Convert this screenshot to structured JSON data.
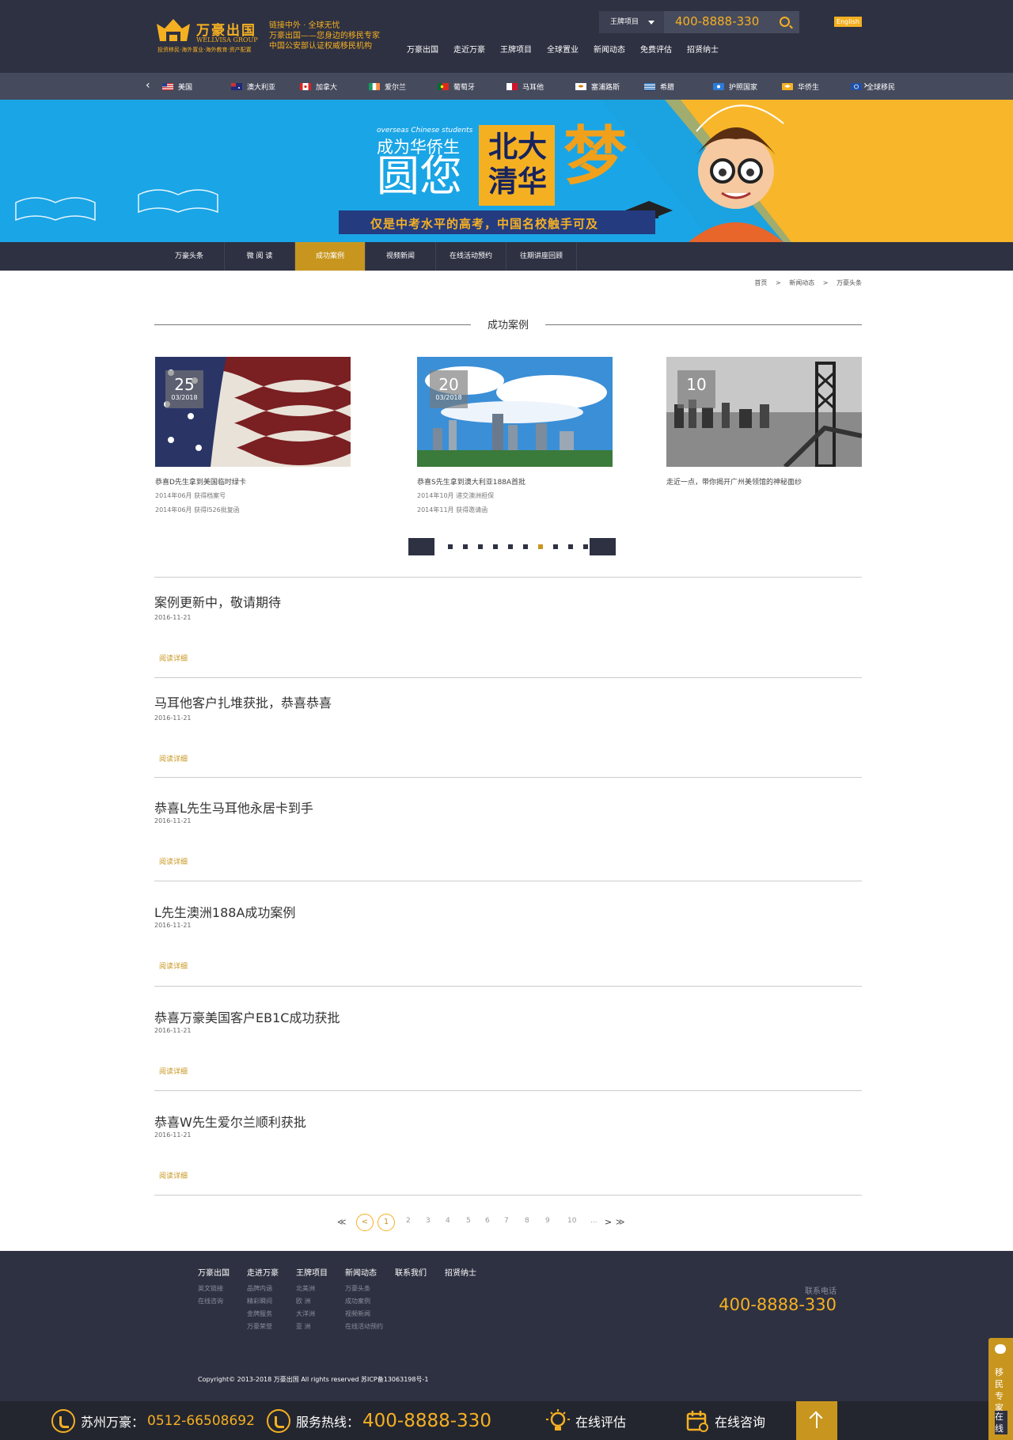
{
  "header": {
    "logo_title": "万豪出国",
    "logo_sub": "WELLVISA GROUP",
    "logo_tag": "投资移民·海外置业·海外教育·资产配置",
    "slogan": [
      "链接中外 · 全球无忧",
      "万豪出国——您身边的移民专家",
      "中国公安部认证权威移民机构"
    ],
    "search_category": "王牌项目",
    "search_phone": "400-8888-330",
    "lang_button": "English",
    "nav": [
      "万豪出国",
      "走近万豪",
      "王牌项目",
      "全球置业",
      "新闻动态",
      "免费评估",
      "招贤纳士"
    ]
  },
  "countries": [
    {
      "label": "美国",
      "flag": "us"
    },
    {
      "label": "澳大利亚",
      "flag": "au"
    },
    {
      "label": "加拿大",
      "flag": "ca"
    },
    {
      "label": "爱尔兰",
      "flag": "ie"
    },
    {
      "label": "葡萄牙",
      "flag": "pt"
    },
    {
      "label": "马耳他",
      "flag": "mt"
    },
    {
      "label": "塞浦路斯",
      "flag": "cy"
    },
    {
      "label": "希腊",
      "flag": "gr"
    },
    {
      "label": "护照国家",
      "flag": "passport"
    },
    {
      "label": "华侨生",
      "flag": "student"
    },
    {
      "label": "全球移民",
      "flag": "global"
    }
  ],
  "banner": {
    "subtitle": "overseas Chinese students",
    "line1": "成为华侨生",
    "line2": "圆您",
    "schools": "北大清华",
    "dream": "梦",
    "ribbon": "仅是中考水平的高考，中国名校触手可及"
  },
  "subnav": [
    {
      "label": "万豪头条",
      "active": false
    },
    {
      "label": "微 阅 读",
      "active": false
    },
    {
      "label": "成功案例",
      "active": true
    },
    {
      "label": "视频新闻",
      "active": false
    },
    {
      "label": "在线活动预约",
      "active": false
    },
    {
      "label": "往期讲座回顾",
      "active": false
    }
  ],
  "breadcrumb": [
    "首页",
    ">",
    "新闻动态",
    ">",
    "万豪头条"
  ],
  "section_title": "成功案例",
  "cards": [
    {
      "day": "25",
      "month": "03/2018",
      "title": "恭喜D先生拿到美国临时绿卡",
      "lines": [
        "2014年06月  获得档案号",
        "2014年06月  获得I526批复函"
      ]
    },
    {
      "day": "20",
      "month": "03/2018",
      "title": "恭喜S先生拿到澳大利亚188A首批",
      "lines": [
        "2014年10月  递交澳洲担保",
        "2014年11月  获得邀请函"
      ]
    },
    {
      "day": "10",
      "month": "",
      "title": "走近一点，带你揭开广州美领馆的神秘面纱",
      "lines": []
    }
  ],
  "news": [
    {
      "title": "案例更新中，敬请期待",
      "date": "2016-11-21",
      "more": "阅读详细"
    },
    {
      "title": "马耳他客户扎堆获批，恭喜恭喜",
      "date": "2016-11-21",
      "more": "阅读详细"
    },
    {
      "title": "恭喜L先生马耳他永居卡到手",
      "date": "2016-11-21",
      "more": "阅读详细"
    },
    {
      "title": "L先生澳洲188A成功案例",
      "date": "2016-11-21",
      "more": "阅读详细"
    },
    {
      "title": "恭喜万豪美国客户EB1C成功获批",
      "date": "2016-11-21",
      "more": "阅读详细"
    },
    {
      "title": "恭喜W先生爱尔兰顺利获批",
      "date": "2016-11-21",
      "more": "阅读详细"
    }
  ],
  "pagination": {
    "first": "≪",
    "prev": "<",
    "current": "1",
    "pages": [
      "2",
      "3",
      "4",
      "5",
      "6",
      "7",
      "8",
      "9",
      "10"
    ],
    "ellipsis": "...",
    "next": ">",
    "last": "≫"
  },
  "footer": {
    "columns": [
      {
        "head": "万豪出国",
        "links": [
          "英文链接",
          "在线咨询"
        ]
      },
      {
        "head": "走进万豪",
        "links": [
          "品牌内涵",
          "精彩瞬间",
          "金牌服务",
          "万豪荣誉"
        ]
      },
      {
        "head": "王牌项目",
        "links": [
          "北美洲",
          "欧  洲",
          "大洋洲",
          "亚  洲"
        ]
      },
      {
        "head": "新闻动态",
        "links": [
          "万豪头条",
          "成功案例",
          "视频新闻",
          "在线活动预约"
        ]
      },
      {
        "head": "联系我们",
        "links": []
      },
      {
        "head": "招贤纳士",
        "links": []
      }
    ],
    "phone_label": "联系电话",
    "phone": "400-8888-330",
    "copyright": "Copyright© 2013-2018   万豪出国    All rights reserved    苏ICP备13063198号-1"
  },
  "bottom_bar": {
    "suzhou_label": "苏州万豪：",
    "suzhou_phone": "0512-66508692",
    "hotline_label": "服务热线：",
    "hotline": "400-8888-330",
    "assess": "在线评估",
    "consult": "在线咨询"
  },
  "side_float": {
    "text": "移民专家",
    "text2": "在线"
  },
  "colors": {
    "accent": "#f5b022",
    "dark": "#2e3142",
    "gold": "#c8961f"
  }
}
